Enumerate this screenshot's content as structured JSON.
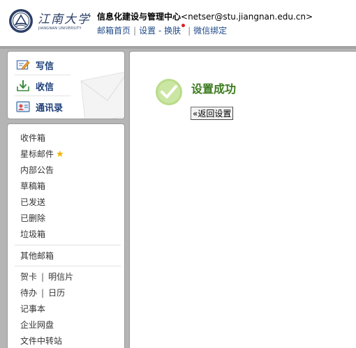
{
  "logo": {
    "cn_name": "江南大学",
    "en_name": "JIANGNAN UNIVERSITY"
  },
  "account": {
    "name": "信息化建设与管理中心",
    "email": "<netser@stu.jiangnan.edu.cn>"
  },
  "nav": {
    "home": "邮箱首页",
    "settings": "设置",
    "dash": "-",
    "skin": "换肤",
    "wechat": "微信绑定"
  },
  "compose": {
    "write": "写信",
    "receive": "收信",
    "contacts": "通讯录"
  },
  "folders": {
    "inbox": "收件箱",
    "starred": "星标邮件",
    "announcements": "内部公告",
    "drafts": "草稿箱",
    "sent": "已发送",
    "deleted": "已删除",
    "junk": "垃圾箱",
    "other_mailboxes": "其他邮箱",
    "greeting_card": "贺卡",
    "postcard": "明信片",
    "todo": "待办",
    "calendar": "日历",
    "notes": "记事本",
    "netdisk": "企业网盘",
    "file_transfer": "文件中转站"
  },
  "main": {
    "success_title": "设置成功",
    "back_button": "«返回设置"
  },
  "colors": {
    "header_nav_link": "#1f4a8a",
    "success_green": "#3a7a1c",
    "check_circle": "#b9dc8a",
    "frame_gray": "#b5b5b5",
    "star_yellow": "#f0b400",
    "notify_dot": "#dd2222"
  },
  "icons": {
    "write": "pencil-note-icon",
    "receive": "download-tray-icon",
    "contacts": "contact-card-icon",
    "success": "checkmark-circle-icon",
    "starred": "star-icon"
  }
}
